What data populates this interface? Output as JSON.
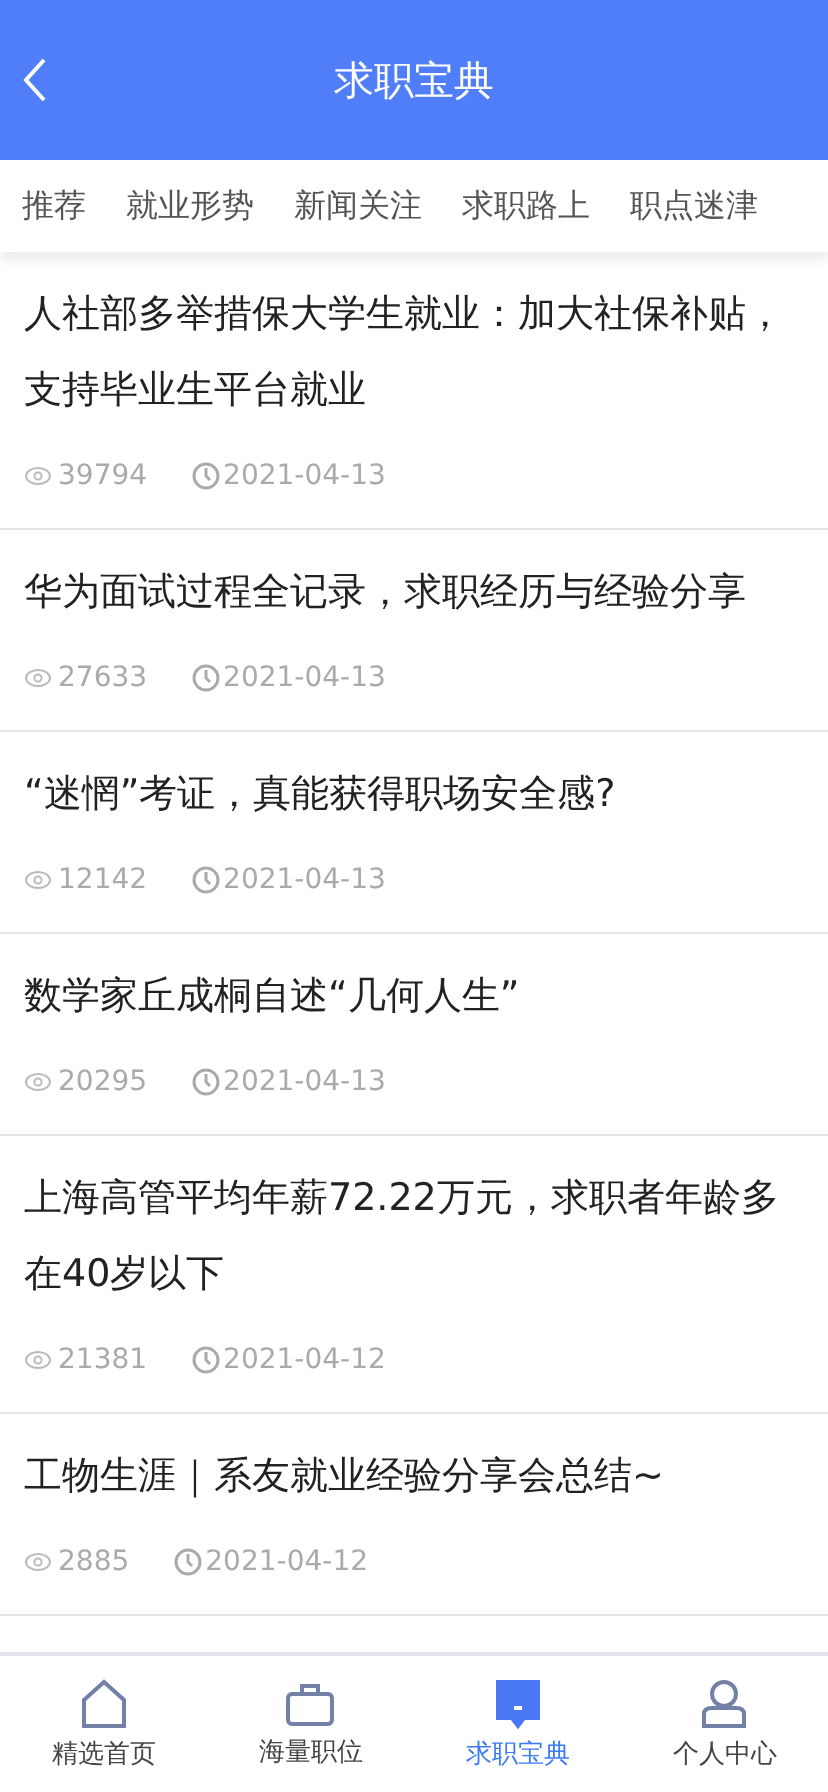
{
  "header": {
    "title": "求职宝典"
  },
  "tabs": [
    {
      "label": "推荐"
    },
    {
      "label": "就业形势"
    },
    {
      "label": "新闻关注"
    },
    {
      "label": "求职路上"
    },
    {
      "label": "职点迷津"
    }
  ],
  "articles": [
    {
      "title": "人社部多举措保大学生就业：加大社保补贴，支持毕业生平台就业",
      "views": "39794",
      "date": "2021-04-13"
    },
    {
      "title": "华为面试过程全记录，求职经历与经验分享",
      "views": "27633",
      "date": "2021-04-13"
    },
    {
      "title": "“迷惘”考证，真能获得职场安全感?",
      "views": "12142",
      "date": "2021-04-13"
    },
    {
      "title": "数学家丘成桐自述“几何人生”",
      "views": "20295",
      "date": "2021-04-13"
    },
    {
      "title": "上海高管平均年薪72.22万元，求职者年龄多在40岁以下",
      "views": "21381",
      "date": "2021-04-12"
    },
    {
      "title": "工物生涯｜系友就业经验分享会总结~",
      "views": "2885",
      "date": "2021-04-12"
    }
  ],
  "bottom_nav": [
    {
      "label": "精选首页",
      "kind": "home",
      "selected": false
    },
    {
      "label": "海量职位",
      "kind": "briefcase",
      "selected": false
    },
    {
      "label": "求职宝典",
      "kind": "book",
      "selected": true
    },
    {
      "label": "个人中心",
      "kind": "person",
      "selected": false
    }
  ]
}
